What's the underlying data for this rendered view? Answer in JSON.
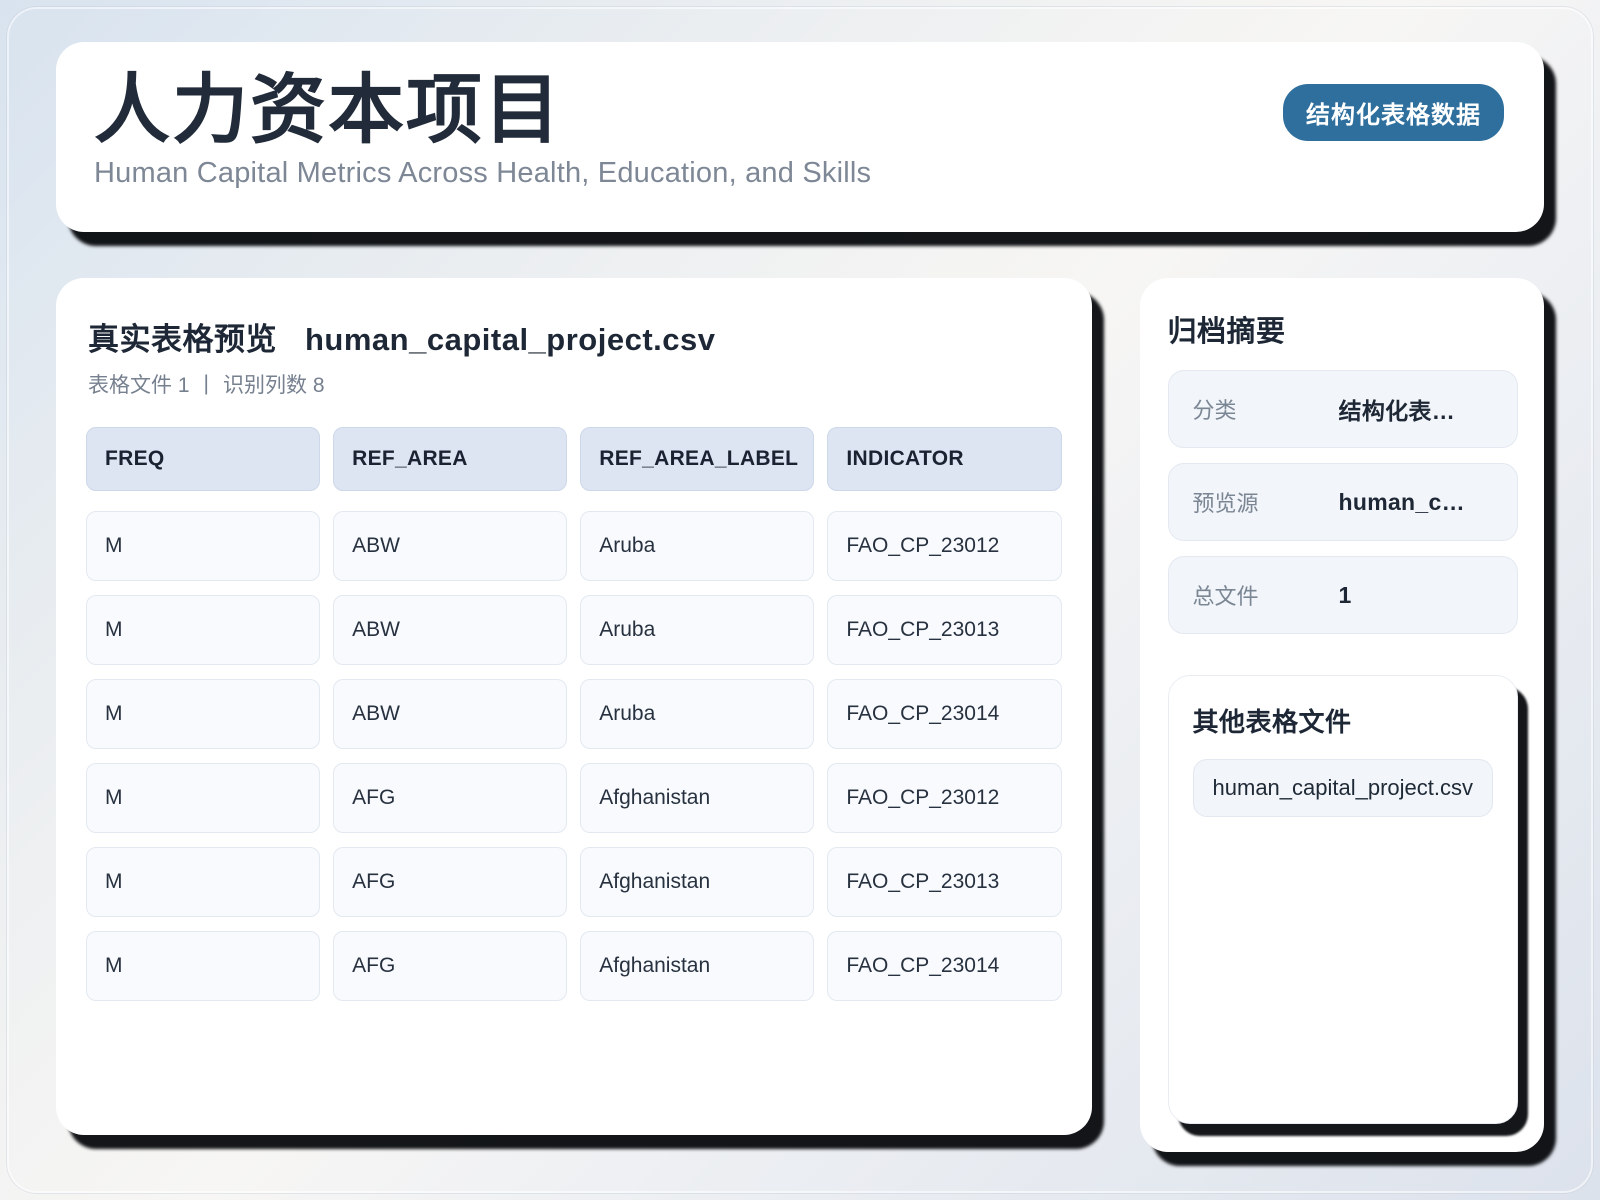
{
  "header": {
    "title": "人力资本项目",
    "subtitle": "Human Capital Metrics Across Health, Education, and Skills",
    "badge": "结构化表格数据"
  },
  "preview": {
    "title": "真实表格预览",
    "filename": "human_capital_project.csv",
    "meta": {
      "files": "表格文件 1",
      "divider": "|",
      "columns": "识别列数 8"
    }
  },
  "table": {
    "columns": [
      "FREQ",
      "REF_AREA",
      "REF_AREA_LABEL",
      "INDICATOR"
    ],
    "rows": [
      [
        "M",
        "ABW",
        "Aruba",
        "FAO_CP_23012"
      ],
      [
        "M",
        "ABW",
        "Aruba",
        "FAO_CP_23013"
      ],
      [
        "M",
        "ABW",
        "Aruba",
        "FAO_CP_23014"
      ],
      [
        "M",
        "AFG",
        "Afghanistan",
        "FAO_CP_23012"
      ],
      [
        "M",
        "AFG",
        "Afghanistan",
        "FAO_CP_23013"
      ],
      [
        "M",
        "AFG",
        "Afghanistan",
        "FAO_CP_23014"
      ]
    ]
  },
  "summary": {
    "title": "归档摘要",
    "stats": [
      {
        "label": "分类",
        "value": "结构化表…"
      },
      {
        "label": "预览源",
        "value": "human_c…"
      },
      {
        "label": "总文件",
        "value": "1"
      }
    ]
  },
  "other_files": {
    "title": "其他表格文件",
    "files": [
      "human_capital_project.csv"
    ]
  },
  "colors": {
    "badge_bg": "#2e6f9d",
    "card_bg": "#ffffff",
    "shadow": "#020408",
    "table_header_bg": "#dde4f2",
    "table_cell_bg": "#f8fafd",
    "stat_row_bg": "#f2f5f9",
    "title_text": "#212b39",
    "muted_text": "#76808f"
  }
}
